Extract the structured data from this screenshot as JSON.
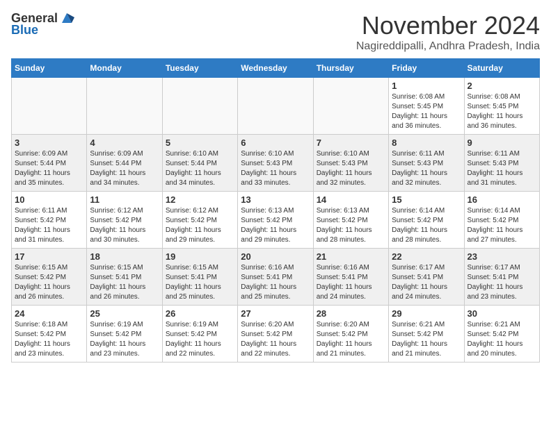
{
  "header": {
    "logo_general": "General",
    "logo_blue": "Blue",
    "month_title": "November 2024",
    "location": "Nagireddipalli, Andhra Pradesh, India"
  },
  "weekdays": [
    "Sunday",
    "Monday",
    "Tuesday",
    "Wednesday",
    "Thursday",
    "Friday",
    "Saturday"
  ],
  "weeks": [
    [
      {
        "day": "",
        "info": ""
      },
      {
        "day": "",
        "info": ""
      },
      {
        "day": "",
        "info": ""
      },
      {
        "day": "",
        "info": ""
      },
      {
        "day": "",
        "info": ""
      },
      {
        "day": "1",
        "info": "Sunrise: 6:08 AM\nSunset: 5:45 PM\nDaylight: 11 hours\nand 36 minutes."
      },
      {
        "day": "2",
        "info": "Sunrise: 6:08 AM\nSunset: 5:45 PM\nDaylight: 11 hours\nand 36 minutes."
      }
    ],
    [
      {
        "day": "3",
        "info": "Sunrise: 6:09 AM\nSunset: 5:44 PM\nDaylight: 11 hours\nand 35 minutes."
      },
      {
        "day": "4",
        "info": "Sunrise: 6:09 AM\nSunset: 5:44 PM\nDaylight: 11 hours\nand 34 minutes."
      },
      {
        "day": "5",
        "info": "Sunrise: 6:10 AM\nSunset: 5:44 PM\nDaylight: 11 hours\nand 34 minutes."
      },
      {
        "day": "6",
        "info": "Sunrise: 6:10 AM\nSunset: 5:43 PM\nDaylight: 11 hours\nand 33 minutes."
      },
      {
        "day": "7",
        "info": "Sunrise: 6:10 AM\nSunset: 5:43 PM\nDaylight: 11 hours\nand 32 minutes."
      },
      {
        "day": "8",
        "info": "Sunrise: 6:11 AM\nSunset: 5:43 PM\nDaylight: 11 hours\nand 32 minutes."
      },
      {
        "day": "9",
        "info": "Sunrise: 6:11 AM\nSunset: 5:43 PM\nDaylight: 11 hours\nand 31 minutes."
      }
    ],
    [
      {
        "day": "10",
        "info": "Sunrise: 6:11 AM\nSunset: 5:42 PM\nDaylight: 11 hours\nand 31 minutes."
      },
      {
        "day": "11",
        "info": "Sunrise: 6:12 AM\nSunset: 5:42 PM\nDaylight: 11 hours\nand 30 minutes."
      },
      {
        "day": "12",
        "info": "Sunrise: 6:12 AM\nSunset: 5:42 PM\nDaylight: 11 hours\nand 29 minutes."
      },
      {
        "day": "13",
        "info": "Sunrise: 6:13 AM\nSunset: 5:42 PM\nDaylight: 11 hours\nand 29 minutes."
      },
      {
        "day": "14",
        "info": "Sunrise: 6:13 AM\nSunset: 5:42 PM\nDaylight: 11 hours\nand 28 minutes."
      },
      {
        "day": "15",
        "info": "Sunrise: 6:14 AM\nSunset: 5:42 PM\nDaylight: 11 hours\nand 28 minutes."
      },
      {
        "day": "16",
        "info": "Sunrise: 6:14 AM\nSunset: 5:42 PM\nDaylight: 11 hours\nand 27 minutes."
      }
    ],
    [
      {
        "day": "17",
        "info": "Sunrise: 6:15 AM\nSunset: 5:42 PM\nDaylight: 11 hours\nand 26 minutes."
      },
      {
        "day": "18",
        "info": "Sunrise: 6:15 AM\nSunset: 5:41 PM\nDaylight: 11 hours\nand 26 minutes."
      },
      {
        "day": "19",
        "info": "Sunrise: 6:15 AM\nSunset: 5:41 PM\nDaylight: 11 hours\nand 25 minutes."
      },
      {
        "day": "20",
        "info": "Sunrise: 6:16 AM\nSunset: 5:41 PM\nDaylight: 11 hours\nand 25 minutes."
      },
      {
        "day": "21",
        "info": "Sunrise: 6:16 AM\nSunset: 5:41 PM\nDaylight: 11 hours\nand 24 minutes."
      },
      {
        "day": "22",
        "info": "Sunrise: 6:17 AM\nSunset: 5:41 PM\nDaylight: 11 hours\nand 24 minutes."
      },
      {
        "day": "23",
        "info": "Sunrise: 6:17 AM\nSunset: 5:41 PM\nDaylight: 11 hours\nand 23 minutes."
      }
    ],
    [
      {
        "day": "24",
        "info": "Sunrise: 6:18 AM\nSunset: 5:42 PM\nDaylight: 11 hours\nand 23 minutes."
      },
      {
        "day": "25",
        "info": "Sunrise: 6:19 AM\nSunset: 5:42 PM\nDaylight: 11 hours\nand 23 minutes."
      },
      {
        "day": "26",
        "info": "Sunrise: 6:19 AM\nSunset: 5:42 PM\nDaylight: 11 hours\nand 22 minutes."
      },
      {
        "day": "27",
        "info": "Sunrise: 6:20 AM\nSunset: 5:42 PM\nDaylight: 11 hours\nand 22 minutes."
      },
      {
        "day": "28",
        "info": "Sunrise: 6:20 AM\nSunset: 5:42 PM\nDaylight: 11 hours\nand 21 minutes."
      },
      {
        "day": "29",
        "info": "Sunrise: 6:21 AM\nSunset: 5:42 PM\nDaylight: 11 hours\nand 21 minutes."
      },
      {
        "day": "30",
        "info": "Sunrise: 6:21 AM\nSunset: 5:42 PM\nDaylight: 11 hours\nand 20 minutes."
      }
    ]
  ]
}
